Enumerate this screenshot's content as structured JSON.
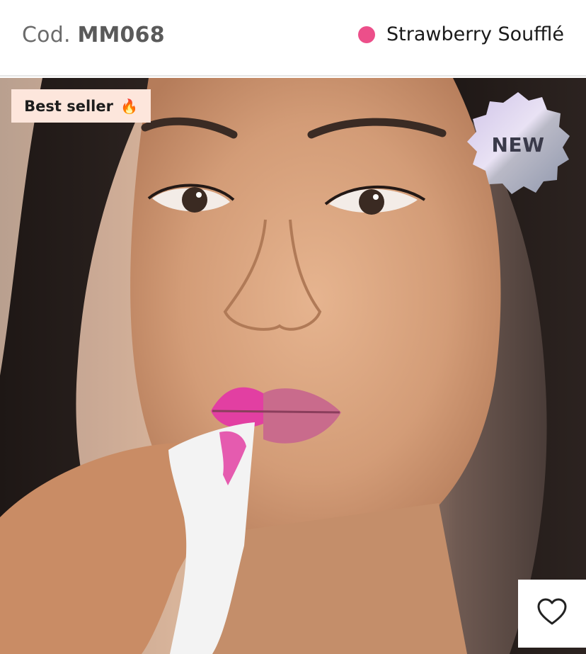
{
  "product": {
    "code_label": "Cod.",
    "code_value": "MM068",
    "shade_name": "Strawberry Soufflé",
    "shade_color": "#ec4f8a"
  },
  "badges": {
    "best_seller": "Best seller",
    "best_seller_icon": "fire-icon",
    "new": "NEW"
  },
  "actions": {
    "favorite_icon": "heart-icon"
  }
}
